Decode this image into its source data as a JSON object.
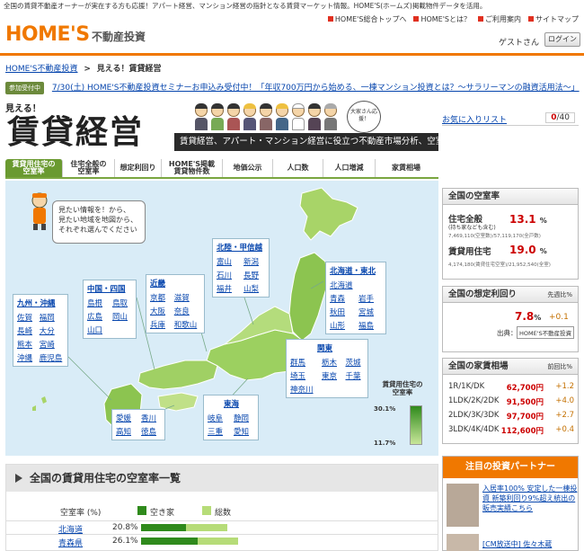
{
  "topbar": {
    "text": "全国の賃貸不動産オーナーが実在する方も応援！アパート経営、マンション経営の指針となる賃貸マーケット情報。HOME'S(ホームズ)掲載物件データを活用。"
  },
  "header": {
    "logo": "HOME'S",
    "logo_sub": "不動産投資",
    "links": [
      "HOME'S総合トップへ",
      "HOME'Sとは？",
      "ご利用案内",
      "サイトマップ"
    ],
    "guest": "ゲストさん",
    "login": "ログイン"
  },
  "breadcrumb": {
    "home": "HOME'S不動産投資",
    "sep": ">",
    "current": "見える！賃貸経営"
  },
  "notice": {
    "badge": "参加受付中",
    "text": "7/30(土) HOME'S不動産投資セミナーお申込み受付中！「年収700万円から始める、一棟マンション投資とは？～サラリーマンの融資活用法～」"
  },
  "title": {
    "mieru": "見える！",
    "main": "賃貸経営",
    "subtitle": "賃貸経営、アパート・マンション経営に役立つ不動産市場分析、空室率情報",
    "owner_bubble": "大家さん応援！"
  },
  "favorites": {
    "label": "お気に入りリスト",
    "count": "0",
    "total": "/40"
  },
  "tabs": [
    {
      "label": "賃貸用住宅の\n空室率",
      "active": true
    },
    {
      "label": "住宅全般の\n空室率",
      "active": false
    },
    {
      "label": "想定利回り",
      "active": false
    },
    {
      "label": "HOME'S掲載\n賃貸物件数",
      "active": false
    },
    {
      "label": "地価公示",
      "active": false
    },
    {
      "label": "人口数",
      "active": false
    },
    {
      "label": "人口増減",
      "active": false
    },
    {
      "label": "家賃相場",
      "active": false
    }
  ],
  "map": {
    "bubble": "見たい情報を！から、\n見たい地域を地図から、\nそれぞれ選んでください",
    "regions": {
      "kyushu": {
        "title": "九州・沖縄",
        "prefs": [
          "佐賀",
          "福岡",
          "長崎",
          "大分",
          "熊本",
          "宮崎",
          "沖縄",
          "鹿児島"
        ]
      },
      "chugoku": {
        "title": "中国・四国",
        "prefs": [
          "島根",
          "鳥取",
          "広島",
          "岡山",
          "山口"
        ]
      },
      "kinki": {
        "title": "近畿",
        "prefs": [
          "京都",
          "滋賀",
          "大阪",
          "奈良",
          "兵庫",
          "和歌山"
        ]
      },
      "hokuriku": {
        "title": "北陸・甲信越",
        "prefs": [
          "富山",
          "新潟",
          "石川",
          "長野",
          "福井",
          "山梨"
        ]
      },
      "tohoku": {
        "title": "北海道・東北",
        "prefs": [
          "北海道",
          "青森",
          "岩手",
          "秋田",
          "宮城",
          "山形",
          "福島"
        ]
      },
      "kanto": {
        "title": "関東",
        "prefs": [
          "群馬",
          "栃木",
          "茨城",
          "埼玉",
          "東京",
          "千葉",
          "神奈川"
        ]
      },
      "tokai": {
        "title": "東海",
        "prefs": [
          "岐阜",
          "静岡",
          "三重",
          "愛知"
        ]
      },
      "shikoku": {
        "prefs": [
          "愛媛",
          "香川",
          "高知",
          "徳島"
        ]
      }
    },
    "legend": {
      "title": "賃貸用住宅の\n空室率",
      "hi": "30.1%",
      "lo": "11.7%"
    }
  },
  "sidebar": {
    "vacancy": {
      "title": "全国の空室率",
      "general_label": "住宅全般",
      "general_note": "(持ち家なども含む)",
      "general_value": "13.1",
      "general_sub": "7,469,110(空室数)/57,119,170(全戸数)",
      "rental_label": "賃貸用住宅",
      "rental_value": "19.0",
      "rental_sub": "4,174,180(賃貸住宅空室)/21,952,540(全室)",
      "pct": "%"
    },
    "yield": {
      "title": "全国の想定利回り",
      "note": "先週比%",
      "value": "7.8",
      "pct": "%",
      "change": "+0.1",
      "source_label": "出典：",
      "source": "HOME'S不動産投資"
    },
    "rent": {
      "title": "全国の家賃相場",
      "note": "前回比%",
      "rows": [
        {
          "label": "1R/1K/DK",
          "value": "62,700円",
          "change": "+1.2"
        },
        {
          "label": "1LDK/2K/2DK",
          "value": "91,500円",
          "change": "+4.0"
        },
        {
          "label": "2LDK/3K/3DK",
          "value": "97,700円",
          "change": "+2.7"
        },
        {
          "label": "3LDK/4K/4DK",
          "value": "112,600円",
          "change": "+0.4"
        }
      ]
    },
    "partner": {
      "title": "注目の投資パートナー",
      "text1": "入居率100% 安定した一棟投資 新築利回り9%超え統出の販売実績こちら",
      "text2": "[CM放送中] 佐々木蔵"
    }
  },
  "list": {
    "title": "全国の賃貸用住宅の空室率一覧",
    "col_rate": "空室率 (%)",
    "legend_vacant": "空き家",
    "legend_total": "総数",
    "rows": [
      {
        "pref": "北海道",
        "value": "20.8%",
        "vac": 20.8,
        "total": 40
      },
      {
        "pref": "青森県",
        "value": "26.1%",
        "vac": 26.1,
        "total": 45
      }
    ]
  }
}
